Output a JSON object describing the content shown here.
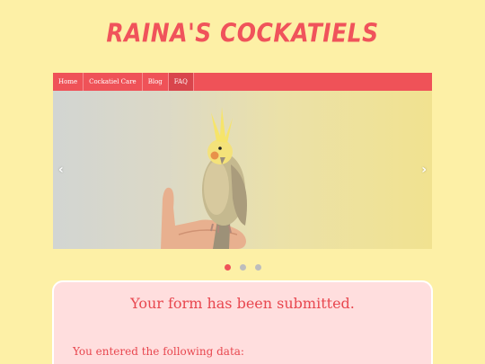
{
  "site": {
    "title": "Raina's Cockatiels"
  },
  "nav": {
    "items": [
      {
        "label": "Home"
      },
      {
        "label": "Cockatiel Care"
      },
      {
        "label": "Blog"
      },
      {
        "label": "FAQ"
      }
    ],
    "active": "FAQ"
  },
  "carousel": {
    "prev_label": "‹",
    "next_label": "›",
    "slide_count": 3,
    "active_slide": 1
  },
  "confirmation": {
    "title": "Your form has been submitted.",
    "subtitle": "You entered the following data:"
  },
  "colors": {
    "background": "#fdf0a6",
    "accent": "#ef5258",
    "card": "#ffdede"
  }
}
